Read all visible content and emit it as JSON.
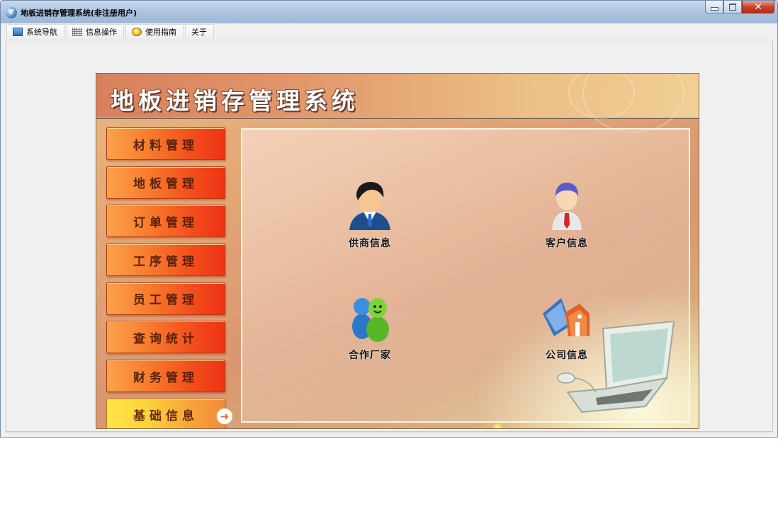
{
  "window": {
    "title": "地板进销存管理系统(非注册用户)",
    "app_icon_letter": "Y",
    "controls": {
      "close": "✕"
    }
  },
  "menu": [
    {
      "label": "系统导航",
      "icon": "nav-icon"
    },
    {
      "label": "信息操作",
      "icon": "grid-icon"
    },
    {
      "label": "使用指南",
      "icon": "help-icon"
    },
    {
      "label": "关于",
      "icon": ""
    }
  ],
  "header": {
    "title": "地板进销存管理系统"
  },
  "sidebar": {
    "items": [
      {
        "label": "材料管理",
        "active": false
      },
      {
        "label": "地板管理",
        "active": false
      },
      {
        "label": "订单管理",
        "active": false
      },
      {
        "label": "工序管理",
        "active": false
      },
      {
        "label": "员工管理",
        "active": false
      },
      {
        "label": "查询统计",
        "active": false
      },
      {
        "label": "财务管理",
        "active": false
      },
      {
        "label": "基础信息",
        "active": true
      }
    ],
    "active_arrow": "➜"
  },
  "tiles": [
    {
      "label": "供商信息",
      "icon": "supplier-person-icon"
    },
    {
      "label": "客户信息",
      "icon": "customer-person-icon"
    },
    {
      "label": "合作厂家",
      "icon": "partner-factory-icon"
    },
    {
      "label": "公司信息",
      "icon": "company-building-icon"
    }
  ],
  "colors": {
    "titlebar": "#a9c1de",
    "sidebar_button": "#f7762a",
    "sidebar_active": "#fbd23a",
    "header_text": "#ffffff"
  }
}
